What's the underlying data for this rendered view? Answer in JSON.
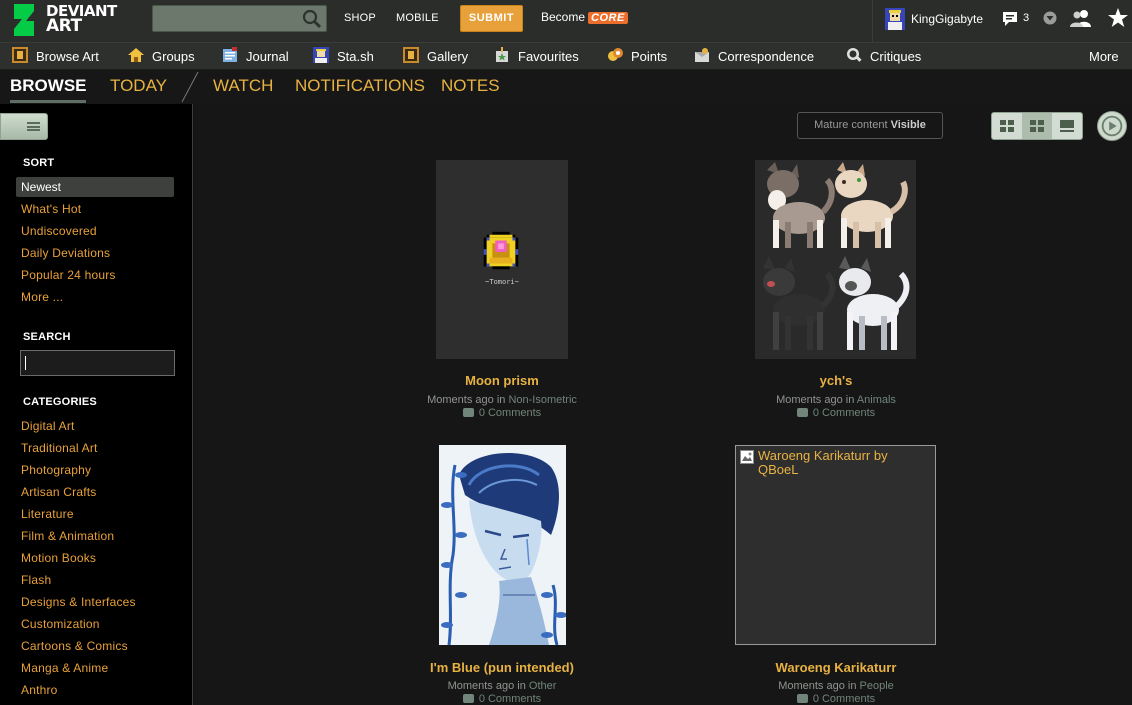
{
  "header": {
    "logo_line1": "DEVIANT",
    "logo_line2": "ART",
    "search_placeholder": "",
    "shop": "SHOP",
    "mobile": "MOBILE",
    "submit": "SUBMIT",
    "become": "Become",
    "core": "CORE",
    "username": "KingGigabyte",
    "message_count": "3"
  },
  "nav": {
    "items": [
      {
        "label": "Browse Art",
        "icon": "browse-art-icon"
      },
      {
        "label": "Groups",
        "icon": "groups-icon"
      },
      {
        "label": "Journal",
        "icon": "journal-icon"
      },
      {
        "label": "Sta.sh",
        "icon": "stash-icon"
      },
      {
        "label": "Gallery",
        "icon": "gallery-icon"
      },
      {
        "label": "Favourites",
        "icon": "favourites-icon"
      },
      {
        "label": "Points",
        "icon": "points-icon"
      },
      {
        "label": "Correspondence",
        "icon": "correspondence-icon"
      },
      {
        "label": "Critiques",
        "icon": "critiques-icon"
      }
    ],
    "more": "More"
  },
  "tabs": {
    "browse": "BROWSE",
    "today": "TODAY",
    "watch": "WATCH",
    "notifications": "NOTIFICATIONS",
    "notes": "NOTES"
  },
  "sidebar": {
    "sort_heading": "SORT",
    "sort_items": [
      "Newest",
      "What's Hot",
      "Undiscovered",
      "Daily Deviations",
      "Popular 24 hours",
      "More ..."
    ],
    "search_heading": "SEARCH",
    "search_value": "",
    "categories_heading": "CATEGORIES",
    "categories": [
      "Digital Art",
      "Traditional Art",
      "Photography",
      "Artisan Crafts",
      "Literature",
      "Film & Animation",
      "Motion Books",
      "Flash",
      "Designs & Interfaces",
      "Customization",
      "Cartoons & Comics",
      "Manga & Anime",
      "Anthro"
    ]
  },
  "main": {
    "mature_label": "Mature content",
    "mature_value": "Visible",
    "deviations": [
      {
        "title": "Moon prism",
        "time": "Moments ago",
        "in": "in",
        "category": "Non-Isometric",
        "comments": "0 Comments",
        "thumb_caption": "~Tomori~"
      },
      {
        "title": "ych's",
        "time": "Moments ago",
        "in": "in",
        "category": "Animals",
        "comments": "0 Comments"
      },
      {
        "title": "I'm Blue (pun intended)",
        "time": "Moments ago",
        "in": "in",
        "category": "Other",
        "comments": "0 Comments"
      },
      {
        "title": "Waroeng Karikaturr",
        "time": "Moments ago",
        "in": "in",
        "category": "People",
        "comments": "0 Comments",
        "broken_image_alt": "Waroeng Karikaturr by QBoeL"
      }
    ]
  },
  "colors": {
    "accent": "#e8b242",
    "link": "#e8a13a",
    "header_bg": "#2b2d2b",
    "core": "#ec6e2c",
    "main_bg": "#161616"
  }
}
